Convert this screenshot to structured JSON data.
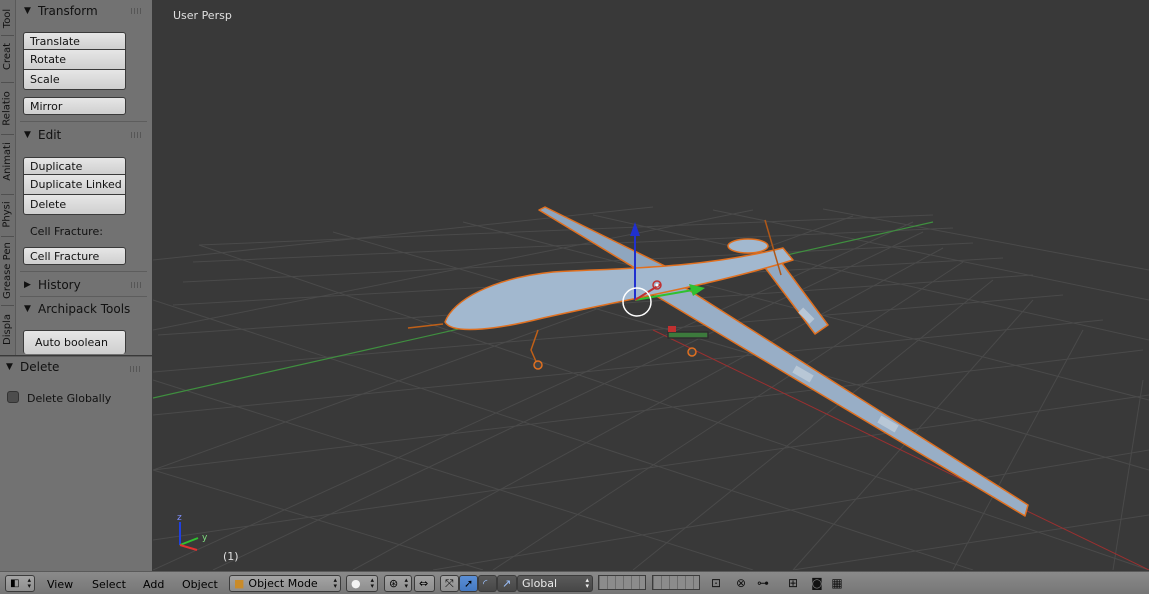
{
  "tool_tabs": [
    "Tool",
    "Creat",
    "Relatio",
    "Animati",
    "Physi",
    "Grease Pen",
    "Displa"
  ],
  "shelf": {
    "transform": {
      "title": "Transform",
      "buttons": [
        "Translate",
        "Rotate",
        "Scale",
        "Mirror"
      ]
    },
    "edit": {
      "title": "Edit",
      "buttons": [
        "Duplicate",
        "Duplicate Linked",
        "Delete"
      ],
      "cell_fracture_label": "Cell Fracture:",
      "cell_fracture_button": "Cell Fracture"
    },
    "history": {
      "title": "History"
    },
    "archipack": {
      "title": "Archipack Tools",
      "auto_boolean": "Auto boolean"
    }
  },
  "operator": {
    "title": "Delete",
    "delete_globally_label": "Delete Globally",
    "delete_globally_checked": false
  },
  "viewport": {
    "view_name": "User Persp",
    "frame": "(1)",
    "axis_labels": {
      "x": "x",
      "y": "y",
      "z": "z"
    },
    "colors": {
      "background": "#393939",
      "grid": "#4a4a4a",
      "x_axis": "#c03030",
      "y_axis": "#40a040",
      "model": "#98aec6",
      "selection": "#e07020"
    }
  },
  "header": {
    "menu": [
      "View",
      "Select",
      "Add",
      "Object"
    ],
    "mode": "Object Mode",
    "orientation": "Global"
  }
}
